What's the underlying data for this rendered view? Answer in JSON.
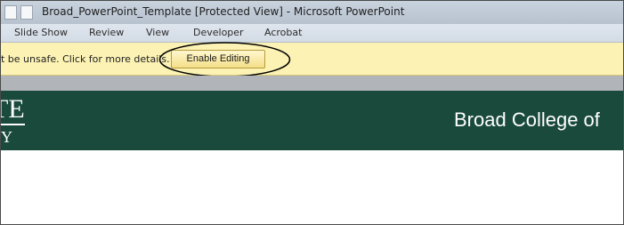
{
  "window": {
    "title": "Broad_PowerPoint_Template [Protected View]  -  Microsoft PowerPoint"
  },
  "ribbon": {
    "tabs": [
      "Slide Show",
      "Review",
      "View",
      "Developer",
      "Acrobat"
    ]
  },
  "message_bar": {
    "text": "t be unsafe. Click for more details.",
    "button_label": "Enable Editing",
    "background": "#fbf2b4"
  },
  "slide": {
    "logo_top": "TE",
    "logo_bottom": "Y",
    "college_text": "Broad College of",
    "banner_color": "#1a4a3b"
  }
}
